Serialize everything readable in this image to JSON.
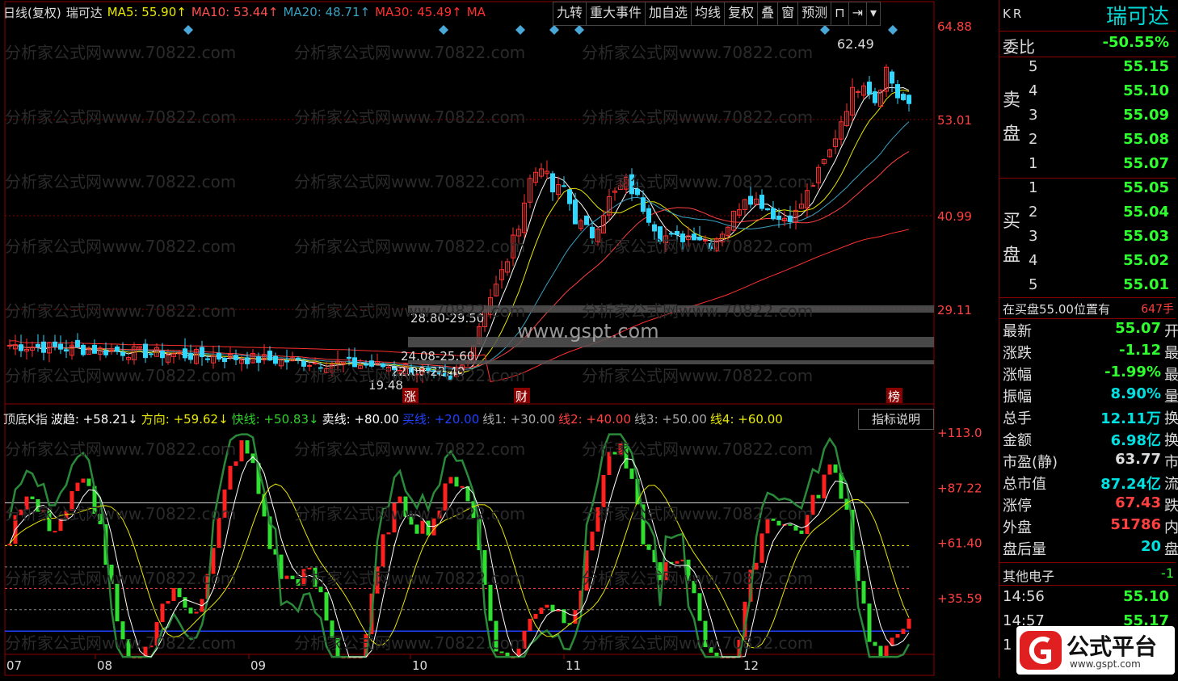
{
  "header": {
    "period": "日线(复权)",
    "stock": "瑞可达",
    "ma5": "MA5: 55.90↑",
    "ma10": "MA10: 53.44↑",
    "ma20": "MA20: 48.71↑",
    "ma30": "MA30: 45.49↑",
    "ma": "MA"
  },
  "toolbar": [
    "九转",
    "重大事件",
    "加自选",
    "均线",
    "复权",
    "叠",
    "窗",
    "预测"
  ],
  "colors": {
    "up": "#ff3030",
    "down": "#30d8ff",
    "ma5": "#ffffff",
    "ma10": "#e8e800",
    "ma20": "#3aa0c0",
    "ma30": "#ff4040",
    "ma60": "#ff3030",
    "grid": "#8b0000"
  },
  "price_axis": [
    "64.88",
    "53.01",
    "40.99",
    "29.11"
  ],
  "annotations": {
    "high": "62.49",
    "low": "19.48",
    "zones": [
      "28.80-29.50",
      "24.08-25.60",
      "22.08-22.40"
    ],
    "events": [
      "涨",
      "财",
      "榜"
    ],
    "watermark": "www.gspt.com",
    "bg_watermark": "分析家公式网www.70822.com"
  },
  "indicator": {
    "name": "顶底K指",
    "items": [
      {
        "t": "波趋: +58.21↓",
        "c": "#ffffff"
      },
      {
        "t": "方向: +59.62↓",
        "c": "#e8e800"
      },
      {
        "t": "快线: +50.83↓",
        "c": "#2fd22f"
      },
      {
        "t": "卖线: +80.00",
        "c": "#ffffff"
      },
      {
        "t": "买线: +20.00",
        "c": "#2040ff"
      },
      {
        "t": "线1: +30.00",
        "c": "#aaaaaa"
      },
      {
        "t": "线2: +40.00",
        "c": "#ff4040"
      },
      {
        "t": "线3: +50.00",
        "c": "#aaaaaa"
      },
      {
        "t": "线4: +60.00",
        "c": "#e8e800"
      }
    ],
    "button": "指标说明",
    "axis": [
      "+113.0",
      "+87.22",
      "+61.40",
      "+35.59"
    ]
  },
  "date_axis": [
    "07",
    "08",
    "09",
    "10",
    "11",
    "12"
  ],
  "panel": {
    "code": "KR",
    "name": "瑞可达",
    "weibi_label": "委比",
    "weibi": "-50.55%",
    "sell_label": [
      "卖",
      "盘"
    ],
    "buy_label": [
      "买",
      "盘"
    ],
    "sell": [
      {
        "n": "5",
        "p": "55.15"
      },
      {
        "n": "4",
        "p": "55.10"
      },
      {
        "n": "3",
        "p": "55.09"
      },
      {
        "n": "2",
        "p": "55.08"
      },
      {
        "n": "1",
        "p": "55.07"
      }
    ],
    "buy": [
      {
        "n": "1",
        "p": "55.05"
      },
      {
        "n": "2",
        "p": "55.04"
      },
      {
        "n": "3",
        "p": "55.03"
      },
      {
        "n": "4",
        "p": "55.02"
      },
      {
        "n": "5",
        "p": "55.01"
      }
    ],
    "notice": "在买盘55.00位置有",
    "notice_val": "647手",
    "stats": [
      {
        "l": "最新",
        "v": "55.07",
        "c": "green",
        "s": "开"
      },
      {
        "l": "涨跌",
        "v": "-1.12",
        "c": "green",
        "s": "最"
      },
      {
        "l": "涨幅",
        "v": "-1.99%",
        "c": "green",
        "s": "最"
      },
      {
        "l": "振幅",
        "v": "8.90%",
        "c": "cyan",
        "s": "量"
      },
      {
        "l": "总手",
        "v": "12.11万",
        "c": "cyan",
        "s": "换"
      },
      {
        "l": "金额",
        "v": "6.98亿",
        "c": "cyan",
        "s": "换"
      },
      {
        "l": "市盈(静)",
        "v": "63.77",
        "c": "white",
        "s": "市"
      },
      {
        "l": "总市值",
        "v": "87.24亿",
        "c": "cyan",
        "s": "流"
      },
      {
        "l": "涨停",
        "v": "67.43",
        "c": "red",
        "s": "跌"
      },
      {
        "l": "外盘",
        "v": "51786",
        "c": "red",
        "s": "内"
      },
      {
        "l": "盘后量",
        "v": "20",
        "c": "cyan",
        "s": "盘"
      }
    ],
    "sector": "其他电子",
    "sector_val": "-1",
    "ticks": [
      {
        "t": "14:56",
        "p": "55.10"
      },
      {
        "t": "14:57",
        "p": "55.17"
      },
      {
        "t": "1",
        "p": ""
      }
    ]
  },
  "logo": {
    "text": "公式平台",
    "url": "www.gspt.com"
  },
  "chart_data": {
    "type": "candlestick",
    "y_axis_ticks": [
      64.88,
      53.01,
      40.99,
      29.11
    ],
    "high": 62.49,
    "low": 19.48,
    "indicator_axis_ticks": [
      113.0,
      87.22,
      61.4,
      35.59
    ]
  }
}
